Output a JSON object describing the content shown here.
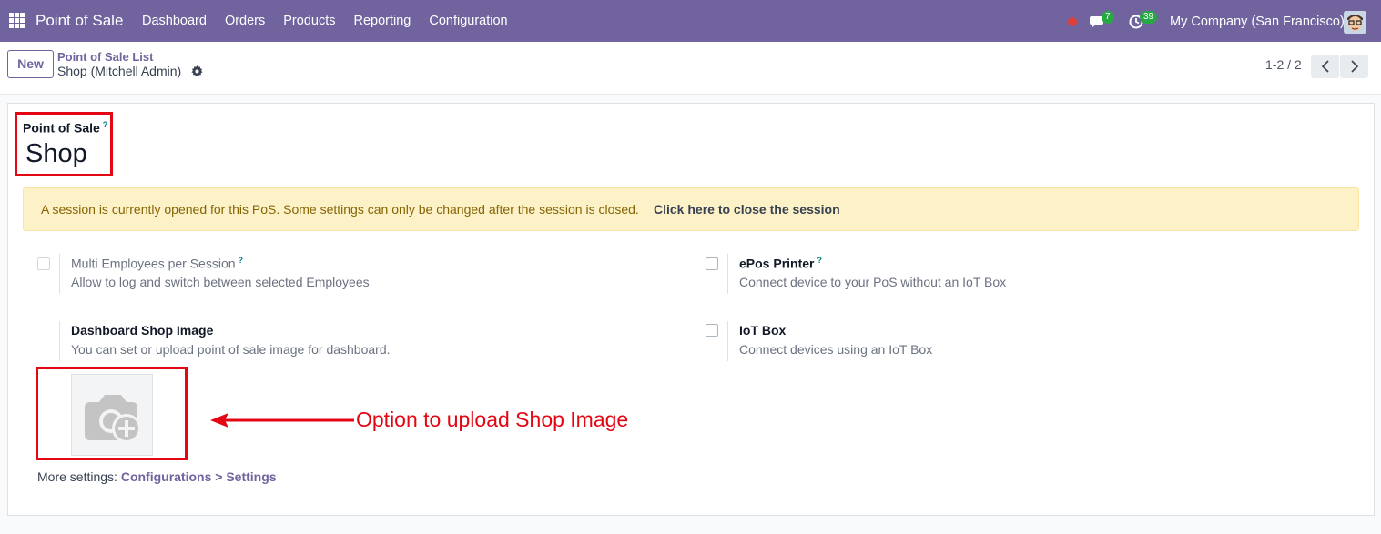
{
  "navbar": {
    "app_name": "Point of Sale",
    "menu": [
      "Dashboard",
      "Orders",
      "Products",
      "Reporting",
      "Configuration"
    ],
    "chat_count": "7",
    "activity_count": "39",
    "company": "My Company (San Francisco)",
    "accent": "#71639e"
  },
  "control": {
    "new_label": "New",
    "breadcrumb_parent": "Point of Sale List",
    "breadcrumb_current": "Shop (Mitchell Admin)",
    "pager": "1-2 / 2"
  },
  "form": {
    "field_label": "Point of Sale",
    "help_mark": "?",
    "name": "Shop",
    "alert_message": "A session is currently opened for this PoS. Some settings can only be changed after the session is closed.",
    "alert_action": "Click here to close the session",
    "settings": [
      {
        "title": "Multi Employees per Session",
        "desc": "Allow to log and switch between selected Employees",
        "checked": false,
        "disabled": true
      },
      {
        "title": "ePos Printer",
        "desc": "Connect device to your PoS without an IoT Box",
        "checked": false,
        "disabled": false
      },
      {
        "title": "Dashboard Shop Image",
        "desc": "You can set or upload point of sale image for dashboard."
      },
      {
        "title": "IoT Box",
        "desc": "Connect devices using an IoT Box",
        "checked": false,
        "disabled": false
      }
    ],
    "more_prefix": "More settings:",
    "more_link": "Configurations > Settings"
  },
  "annotation": {
    "text": "Option to upload Shop Image",
    "color": "#e30613"
  }
}
